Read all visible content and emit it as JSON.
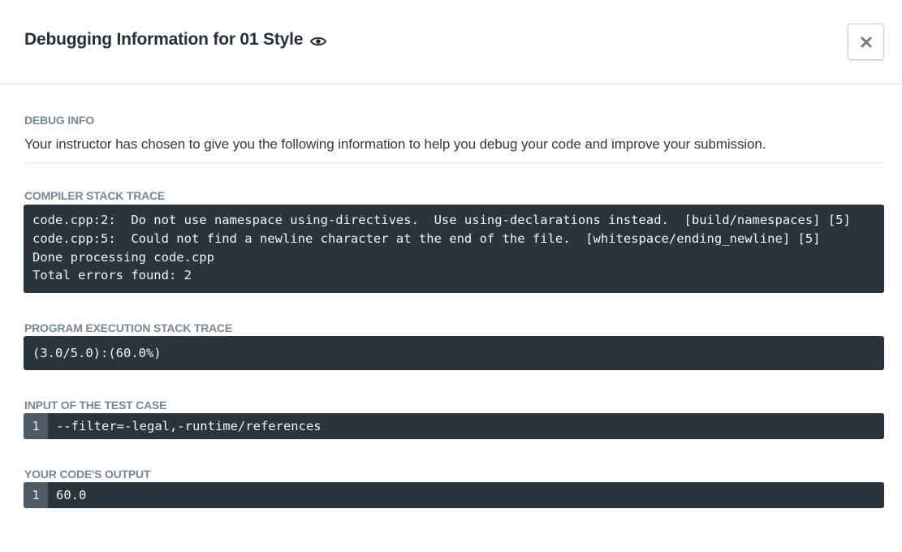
{
  "modal": {
    "title": "Debugging Information for 01 Style",
    "eye_icon": "eye-icon",
    "close_icon": "close-icon"
  },
  "debug_info": {
    "label": "DEBUG INFO",
    "text": "Your instructor has chosen to give you the following information to help you debug your code and improve your submission."
  },
  "compiler_trace": {
    "label": "COMPILER STACK TRACE",
    "content": "code.cpp:2:  Do not use namespace using-directives.  Use using-declarations instead.  [build/namespaces] [5]\ncode.cpp:5:  Could not find a newline character at the end of the file.  [whitespace/ending_newline] [5]\nDone processing code.cpp\nTotal errors found: 2"
  },
  "execution_trace": {
    "label": "PROGRAM EXECUTION STACK TRACE",
    "content": "(3.0/5.0):(60.0%)"
  },
  "test_input": {
    "label": "INPUT OF THE TEST CASE",
    "line_number": "1",
    "content": "--filter=-legal,-runtime/references"
  },
  "code_output": {
    "label": "YOUR CODE'S OUTPUT",
    "line_number": "1",
    "content": "60.0"
  },
  "colors": {
    "code_background": "#2b333b",
    "gutter_background": "#4d5a66",
    "label_color": "#7a8894"
  }
}
